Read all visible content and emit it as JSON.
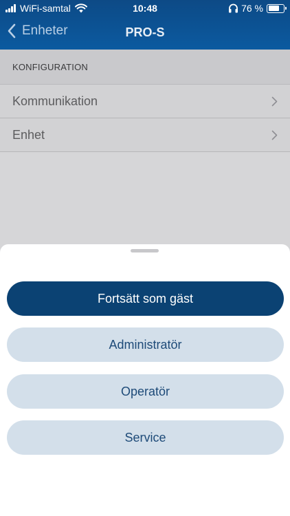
{
  "status_bar": {
    "carrier": "WiFi-samtal",
    "time": "10:48",
    "battery_percent": "76 %",
    "battery_level": 0.76
  },
  "nav": {
    "back_label": "Enheter",
    "title": "PRO-S"
  },
  "section": {
    "header": "KONFIGURATION",
    "items": [
      {
        "label": "Kommunikation"
      },
      {
        "label": "Enhet"
      }
    ]
  },
  "sheet": {
    "buttons": [
      {
        "label": "Fortsätt som gäst"
      },
      {
        "label": "Administratör"
      },
      {
        "label": "Operatör"
      },
      {
        "label": "Service"
      }
    ]
  },
  "colors": {
    "header_blue": "#0d4a86",
    "primary_button": "#0b4273",
    "secondary_button": "#d3dfea"
  },
  "icons": [
    "cellular-signal-icon",
    "wifi-icon",
    "headphones-icon",
    "battery-icon",
    "back-chevron-icon",
    "chevron-right-icon"
  ]
}
